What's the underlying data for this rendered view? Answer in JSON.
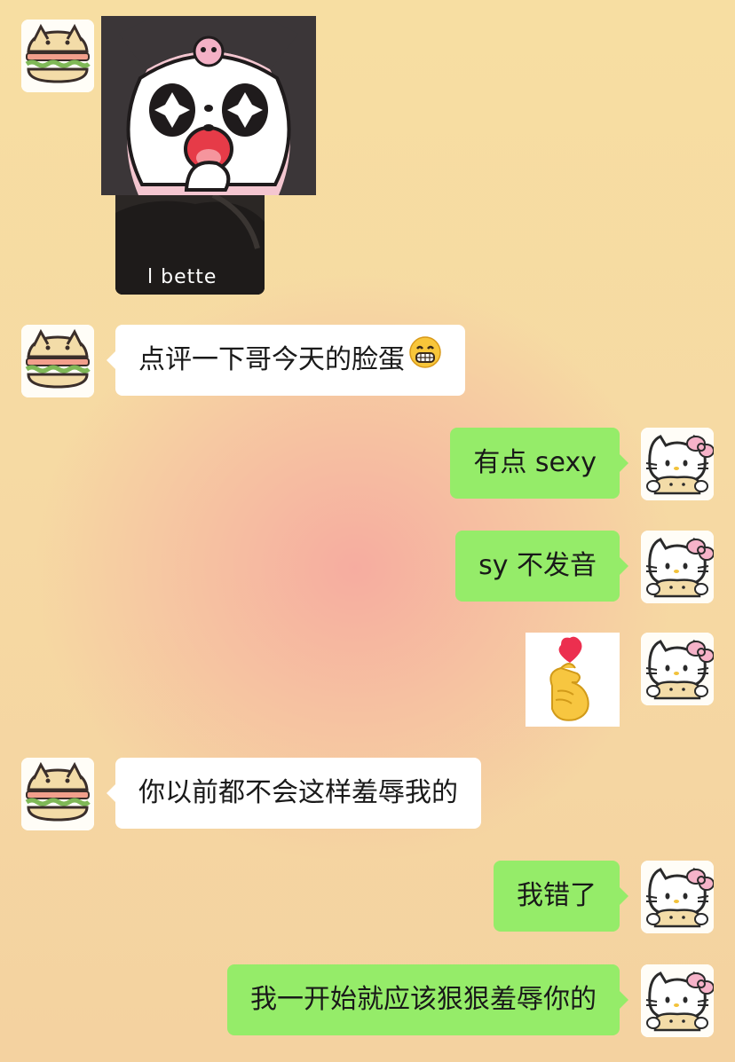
{
  "messages": [
    {
      "type": "sticker",
      "from": "other",
      "image_description": "kuromi-surprised-sticker-over-photo",
      "photo_text": "l bette"
    },
    {
      "type": "text",
      "from": "other",
      "text": "点评一下哥今天的脸蛋",
      "emoji": "grinning-face"
    },
    {
      "type": "text",
      "from": "me",
      "text": "有点 sexy"
    },
    {
      "type": "text",
      "from": "me",
      "text": "sy 不发音"
    },
    {
      "type": "sticker",
      "from": "me",
      "image_description": "finger-heart-hand"
    },
    {
      "type": "text",
      "from": "other",
      "text": "你以前都不会这样羞辱我的"
    },
    {
      "type": "text",
      "from": "me",
      "text": "我错了"
    },
    {
      "type": "text",
      "from": "me",
      "text": "我一开始就应该狠狠羞辱你的"
    }
  ],
  "avatars": {
    "other": "hamburger-cat-avatar",
    "me": "hello-kitty-avatar"
  },
  "colors": {
    "bubble_out": "#95ec69",
    "bubble_in": "#ffffff",
    "background_top": "#f7dea2",
    "background_glow": "#f6aaa0"
  }
}
